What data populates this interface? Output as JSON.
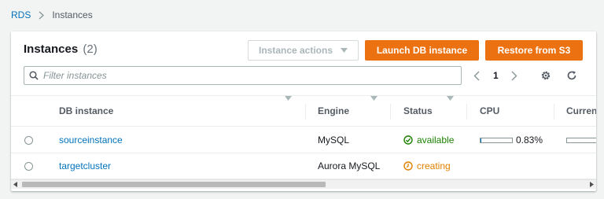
{
  "breadcrumb": {
    "root": "RDS",
    "current": "Instances"
  },
  "panel": {
    "title": "Instances",
    "count": "(2)",
    "actions_label": "Instance actions",
    "launch_label": "Launch DB instance",
    "restore_label": "Restore from S3"
  },
  "search": {
    "placeholder": "Filter instances",
    "value": ""
  },
  "pagination": {
    "page": "1"
  },
  "icons": [
    "chevron-right-icon",
    "caret-down-icon",
    "search-icon",
    "chevron-left-icon",
    "chevron-right-icon",
    "gear-icon",
    "refresh-icon",
    "sort-icon",
    "radio-icon",
    "check-circle-icon",
    "clock-icon"
  ],
  "colors": {
    "primary": "#ec7211",
    "link": "#0073bb",
    "available": "#1d8102",
    "creating": "#df8100"
  },
  "table": {
    "columns": [
      "DB instance",
      "Engine",
      "Status",
      "CPU",
      "Curren"
    ],
    "rows": [
      {
        "name": "sourceinstance",
        "engine": "MySQL",
        "status": "available",
        "status_type": "available",
        "cpu_text": "0.83%",
        "cpu_fraction": 0.0083
      },
      {
        "name": "targetcluster",
        "engine": "Aurora MySQL",
        "status": "creating",
        "status_type": "creating",
        "cpu_text": "",
        "cpu_fraction": null
      }
    ]
  }
}
